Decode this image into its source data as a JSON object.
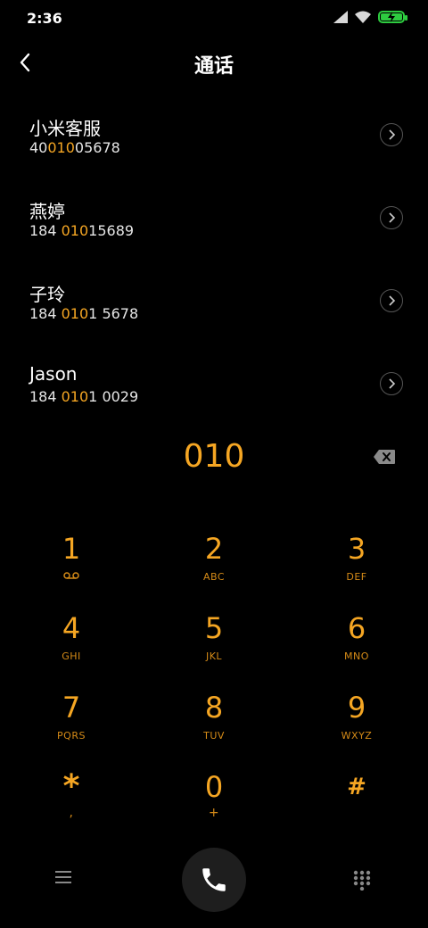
{
  "status": {
    "time": "2:36"
  },
  "header": {
    "title": "通话"
  },
  "contacts": [
    {
      "name": "小米客服",
      "number_parts": [
        "40",
        "010",
        "05678"
      ]
    },
    {
      "name": "燕婷",
      "number_parts": [
        "184 ",
        "010",
        "15689"
      ]
    },
    {
      "name": "子玲",
      "number_parts": [
        "184 ",
        "010",
        "1 5678"
      ]
    },
    {
      "name": "Jason",
      "number_parts": [
        "184 ",
        "010",
        "1 0029"
      ]
    }
  ],
  "dialer": {
    "entry": "010"
  },
  "keypad": [
    {
      "digit": "1",
      "sub": ""
    },
    {
      "digit": "2",
      "sub": "ABC"
    },
    {
      "digit": "3",
      "sub": "DEF"
    },
    {
      "digit": "4",
      "sub": "GHI"
    },
    {
      "digit": "5",
      "sub": "JKL"
    },
    {
      "digit": "6",
      "sub": "MNO"
    },
    {
      "digit": "7",
      "sub": "PQRS"
    },
    {
      "digit": "8",
      "sub": "TUV"
    },
    {
      "digit": "9",
      "sub": "WXYZ"
    },
    {
      "digit": "*",
      "sub": ","
    },
    {
      "digit": "0",
      "sub": "+"
    },
    {
      "digit": "#",
      "sub": ""
    }
  ],
  "colors": {
    "accent": "#f5a623",
    "background": "#000000",
    "battery": "#2ecc40"
  },
  "icons": {
    "back": "chevron-left-icon",
    "arrow": "chevron-right-icon",
    "backspace": "backspace-icon",
    "voicemail": "voicemail-icon",
    "menu": "menu-icon",
    "call": "phone-icon",
    "dialpad": "dialpad-icon"
  }
}
